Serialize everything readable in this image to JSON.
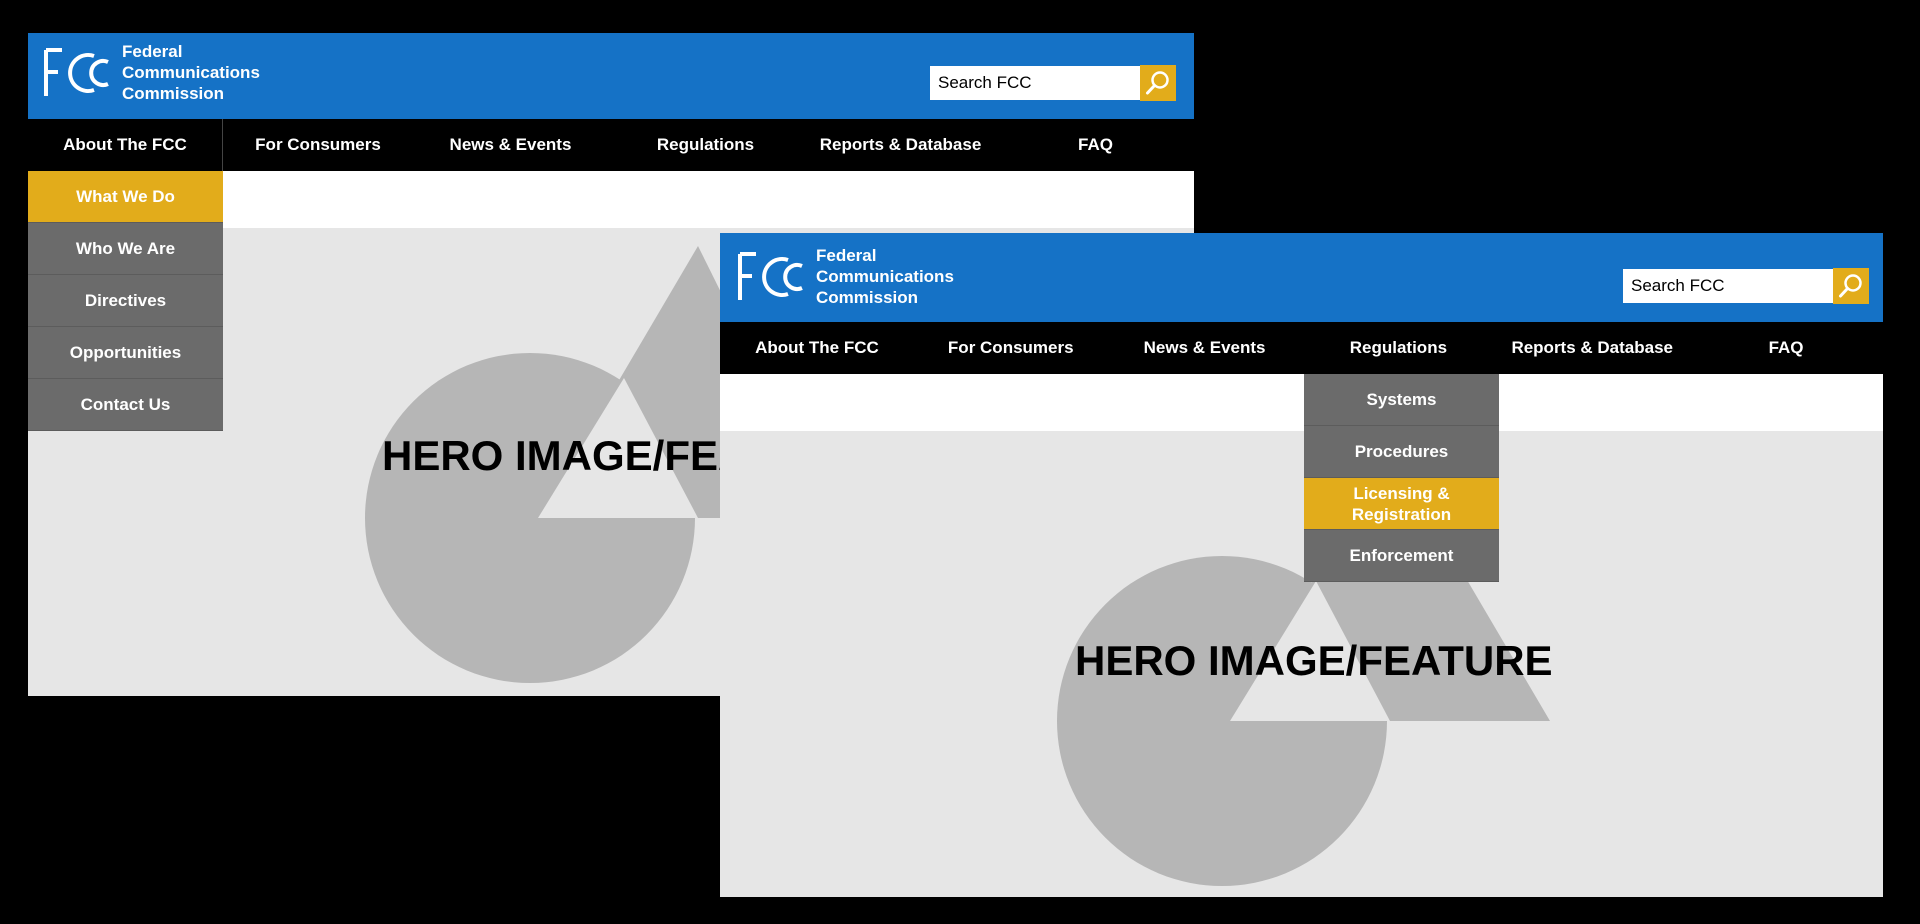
{
  "colors": {
    "header": "#1572c6",
    "accent": "#e2ac1b",
    "dropdown": "#6b6b6b",
    "nav": "#000000",
    "hero_bg": "#e6e6e6"
  },
  "logo": {
    "mark": "FCC",
    "line1": "Federal",
    "line2": "Communications",
    "line3": "Commission"
  },
  "search": {
    "value": "Search FCC",
    "icon": "magnifier-icon"
  },
  "nav": [
    "About The FCC",
    "For Consumers",
    "News & Events",
    "Regulations",
    "Reports & Database",
    "FAQ"
  ],
  "about_menu": [
    {
      "label": "What We Do",
      "active": true
    },
    {
      "label": "Who We Are",
      "active": false
    },
    {
      "label": "Directives",
      "active": false
    },
    {
      "label": "Opportunities",
      "active": false
    },
    {
      "label": "Contact Us",
      "active": false
    }
  ],
  "regulations_menu": [
    {
      "label": "Systems",
      "active": false
    },
    {
      "label": "Procedures",
      "active": false
    },
    {
      "label": "Licensing & Registration",
      "active": true
    },
    {
      "label": "Enforcement",
      "active": false
    }
  ],
  "hero": {
    "title_full": "HERO IMAGE/FEATURE",
    "title_clipped": "HERO IMAGE/FEA"
  }
}
